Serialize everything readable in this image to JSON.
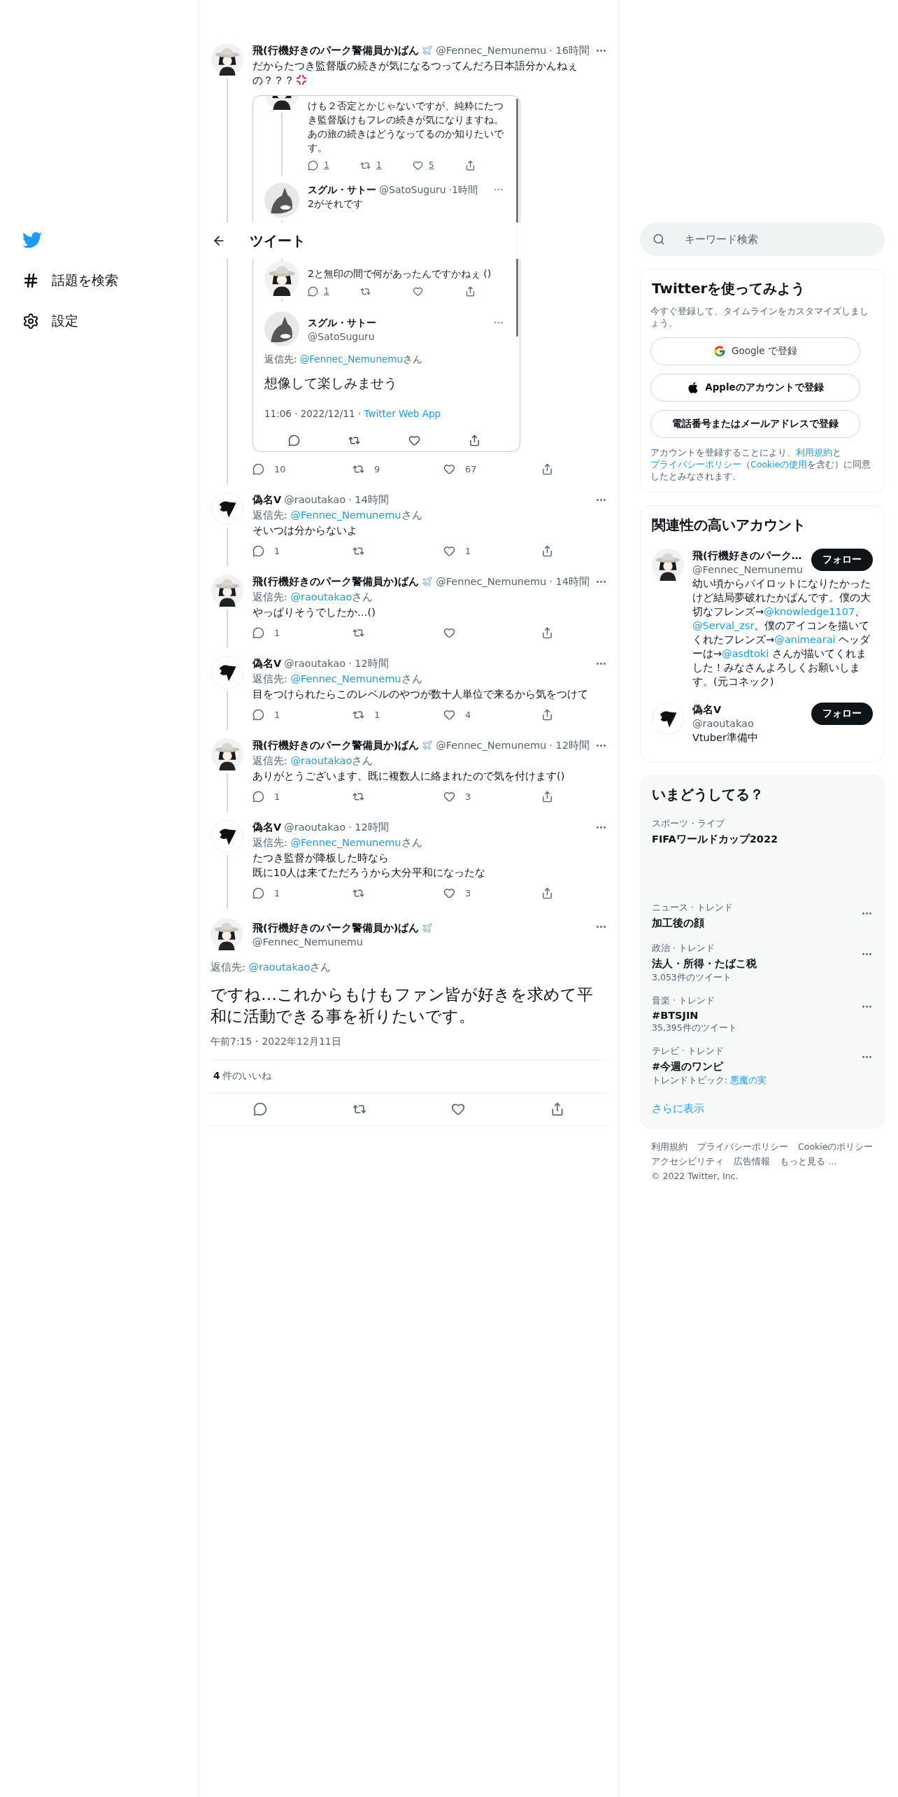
{
  "sidebar": {
    "items": [
      {
        "kind": "logo"
      },
      {
        "kind": "explore",
        "label": "話題を検索"
      },
      {
        "kind": "settings",
        "label": "設定"
      }
    ]
  },
  "header": {
    "title": "ツイート"
  },
  "thread": [
    {
      "avatar": {
        "kind": "hat"
      },
      "name": "飛(行機好きのパーク警備員か)ばん",
      "badge": {
        "kind": "plane"
      },
      "handle": "@Fennec_Nemunemu",
      "time": "· 16時間",
      "text": "だからたつき監督版の続きが気になるつってんだろ日本語分かんねぇの？？？",
      "emoji": {
        "kind": "anger"
      },
      "embed": {
        "items": [
          {
            "kind": "continued",
            "avatar": {
              "kind": "hat"
            },
            "text": "けも２否定とかじゃないですが、純粋にたつき監督版けもフレの続きが気になりますね。あの旅の続きはどうなってるのか知りたいです。",
            "actions": {
              "reply": "1",
              "retweet": "1",
              "like": "5"
            }
          },
          {
            "kind": "tweet",
            "avatar": {
              "kind": "orca"
            },
            "name": "スグル・サトー",
            "handle": "@SatoSuguru",
            "time": "·1時間",
            "text": "2がそれです"
          },
          {
            "kind": "continued",
            "avatar": {
              "kind": "hat"
            },
            "text": "2と無印の間で何があったんですかねぇ ()",
            "actions": {
              "reply": "1"
            }
          },
          {
            "kind": "focus",
            "avatar": {
              "kind": "orca"
            },
            "name": "スグル・サトー",
            "handle": "@SatoSuguru",
            "reply_to": {
              "label": "返信先: ",
              "mention": "@Fennec_Nemunemu",
              "suffix": "さん"
            },
            "text": "想像して楽しみませう",
            "meta": "11:06 · 2022/12/11 · ",
            "source": "Twitter Web App"
          }
        ]
      },
      "actions": {
        "reply": "10",
        "retweet": "9",
        "like": "67"
      }
    },
    {
      "avatar": {
        "kind": "mark"
      },
      "name": "偽名V",
      "handle": "@raoutakao",
      "time": "· 14時間",
      "reply_to": {
        "label": "返信先: ",
        "mention": "@Fennec_Nemunemu",
        "suffix": "さん"
      },
      "text": "そいつは分からないよ",
      "actions": {
        "reply": "1",
        "like": "1"
      }
    },
    {
      "avatar": {
        "kind": "hat"
      },
      "name": "飛(行機好きのパーク警備員か)ばん",
      "badge": {
        "kind": "plane"
      },
      "handle": "@Fennec_Nemunemu",
      "time": "· 14時間",
      "reply_to": {
        "label": "返信先: ",
        "mention": "@raoutakao",
        "suffix": "さん"
      },
      "text": "やっぱりそうでしたか…()",
      "actions": {
        "reply": "1"
      }
    },
    {
      "avatar": {
        "kind": "mark"
      },
      "name": "偽名V",
      "handle": "@raoutakao",
      "time": "· 12時間",
      "reply_to": {
        "label": "返信先: ",
        "mention": "@Fennec_Nemunemu",
        "suffix": "さん"
      },
      "text": "目をつけられたらこのレベルのやつが数十人単位で来るから気をつけて",
      "actions": {
        "reply": "1",
        "retweet": "1",
        "like": "4"
      }
    },
    {
      "avatar": {
        "kind": "hat"
      },
      "name": "飛(行機好きのパーク警備員か)ばん",
      "badge": {
        "kind": "plane"
      },
      "handle": "@Fennec_Nemunemu",
      "time": "· 12時間",
      "reply_to": {
        "label": "返信先: ",
        "mention": "@raoutakao",
        "suffix": "さん"
      },
      "text": "ありがとうございます、既に複数人に絡まれたので気を付けます()",
      "actions": {
        "reply": "1",
        "like": "3"
      }
    },
    {
      "avatar": {
        "kind": "mark"
      },
      "name": "偽名V",
      "handle": "@raoutakao",
      "time": "· 12時間",
      "reply_to": {
        "label": "返信先: ",
        "mention": "@Fennec_Nemunemu",
        "suffix": "さん"
      },
      "text": "たつき監督が降板した時なら",
      "text_line_2": "既に10人は来てただろうから大分平和になったな",
      "actions": {
        "reply": "1",
        "like": "3"
      }
    }
  ],
  "main_tweet": {
    "avatar": {
      "kind": "hat"
    },
    "name": "飛(行機好きのパーク警備員か)ばん",
    "badge": {
      "kind": "plane"
    },
    "handle": "@Fennec_Nemunemu",
    "reply_to": {
      "label": "返信先: ",
      "mention": "@raoutakao",
      "suffix": "さん"
    },
    "text": "ですね…これからもけもファン皆が好きを求めて平和に活動できる事を祈りたいです。",
    "time": "午前7:15・2022年12月11日",
    "likes_count": "4",
    "likes_label": "件のいいね"
  },
  "search": {
    "placeholder": "キーワード検索"
  },
  "signup": {
    "title": "Twitterを使ってみよう",
    "subtitle": "今すぐ登録して、タイムラインをカスタマイズしましょう。",
    "buttons": [
      {
        "kind": "google",
        "label": "Google で登録"
      },
      {
        "kind": "apple",
        "label": "Appleのアカウントで登録"
      },
      {
        "kind": "phone",
        "label": "電話番号またはメールアドレスで登録"
      }
    ],
    "legal": [
      {
        "kind": "text",
        "text": "アカウントを登録することにより、"
      },
      {
        "kind": "link",
        "text": "利用規約"
      },
      {
        "kind": "text",
        "text": "と"
      },
      {
        "kind": "link",
        "text": "プライバシーポリシー"
      },
      {
        "kind": "text",
        "text": "（"
      },
      {
        "kind": "link",
        "text": "Cookieの使用"
      },
      {
        "kind": "text",
        "text": "を含む）に同意したとみなされます。"
      }
    ]
  },
  "accounts": {
    "title": "関連性の高いアカウント",
    "items": [
      {
        "avatar": {
          "kind": "hat"
        },
        "name": "飛(行機好きのパーク…",
        "handle": "@Fennec_Nemunemu",
        "button": "フォロー",
        "bio": [
          {
            "kind": "text",
            "text": "幼い頃からパイロットになりたかったけど結局夢破れたかばんです。僕の大切なフレンズ→"
          },
          {
            "kind": "link",
            "text": "@knowledge1107"
          },
          {
            "kind": "text",
            "text": "、"
          },
          {
            "kind": "link",
            "text": "@Serval_zsr"
          },
          {
            "kind": "text",
            "text": "、僕のアイコンを描いてくれたフレンズ→"
          },
          {
            "kind": "link",
            "text": "@animearai"
          },
          {
            "kind": "text",
            "text": " ヘッダーは→"
          },
          {
            "kind": "link",
            "text": "@asdtoki"
          },
          {
            "kind": "text",
            "text": " さんが描いてくれました！みなさんよろしくお願いします。(元コネック)"
          }
        ]
      },
      {
        "avatar": {
          "kind": "mark"
        },
        "name": "偽名V",
        "handle": "@raoutakao",
        "button": "フォロー",
        "bio": [
          {
            "kind": "text",
            "text": "Vtuber準備中"
          }
        ]
      }
    ]
  },
  "trends": {
    "title": "いまどうしてる？",
    "items": [
      {
        "kind": "live",
        "category": "スポーツ・ライブ",
        "name": "FIFAワールドカップ2022"
      },
      {
        "kind": "trend",
        "category": "ニュース · トレンド",
        "name": "加工後の顔"
      },
      {
        "kind": "trend",
        "category": "政治 · トレンド",
        "name": "法人・所得・たばこ税",
        "count": "3,053件のツイート"
      },
      {
        "kind": "trend",
        "category": "音楽 · トレンド",
        "name": "#BTSJIN",
        "count": "35,395件のツイート"
      },
      {
        "kind": "trend",
        "category": "テレビ · トレンド",
        "name": "#今週のワンピ",
        "topic_label": "トレンドトピック: ",
        "topic": "悪魔の実"
      }
    ],
    "show_more": "さらに表示"
  },
  "footer": {
    "links": [
      "利用規約",
      "プライバシーポリシー",
      "Cookieのポリシー",
      "アクセシビリティ",
      "広告情報",
      "もっと見る …"
    ],
    "copyright": "© 2022 Twitter, Inc."
  }
}
